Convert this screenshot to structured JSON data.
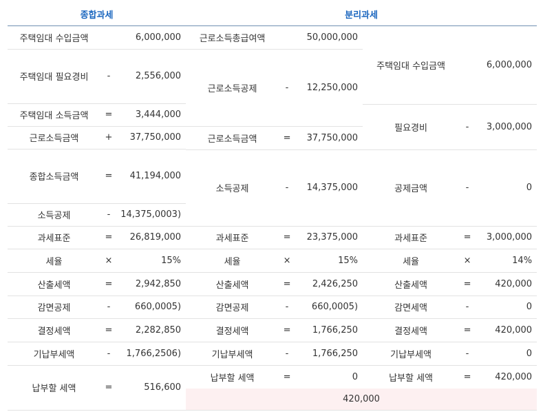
{
  "headers": {
    "combined": "종합과세",
    "separate": "분리과세"
  },
  "col1": {
    "r1": {
      "label": "주택임대 수입금액",
      "op": "",
      "value": "6,000,000"
    },
    "r2": {
      "label": "주택임대 필요경비",
      "op": "-",
      "value": "2,556,000"
    },
    "r3": {
      "label": "주택임대 소득금액",
      "op": "=",
      "value": "3,444,000"
    },
    "r4": {
      "label": "근로소득금액",
      "op": "+",
      "value": "37,750,000"
    },
    "r5": {
      "label": "종합소득금액",
      "op": "=",
      "value": "41,194,000"
    },
    "r6": {
      "label": "소득공제",
      "op": "-",
      "value": "14,375,0003)"
    },
    "r7": {
      "label": "과세표준",
      "op": "=",
      "value": "26,819,000"
    },
    "r8": {
      "label": "세율",
      "op": "×",
      "value": "15%"
    },
    "r9": {
      "label": "산출세액",
      "op": "=",
      "value": "2,942,850"
    },
    "r10": {
      "label": "감면공제",
      "op": "-",
      "value": "660,0005)"
    },
    "r11": {
      "label": "결정세액",
      "op": "=",
      "value": "2,282,850"
    },
    "r12": {
      "label": "기납부세액",
      "op": "-",
      "value": "1,766,2506)"
    },
    "r13": {
      "label": "납부할 세액",
      "op": "=",
      "value": "516,600"
    }
  },
  "col2": {
    "r1": {
      "label": "근로소득총급여액",
      "op": "",
      "value": "50,000,000"
    },
    "r2": {
      "label": "근로소득공제",
      "op": "-",
      "value": "12,250,000"
    },
    "r3": {
      "label": "근로소득금액",
      "op": "=",
      "value": "37,750,000"
    },
    "r4": {
      "label": "소득공제",
      "op": "-",
      "value": "14,375,000"
    },
    "r5": {
      "label": "과세표준",
      "op": "=",
      "value": "23,375,000"
    },
    "r6": {
      "label": "세율",
      "op": "×",
      "value": "15%"
    },
    "r7": {
      "label": "산출세액",
      "op": "=",
      "value": "2,426,250"
    },
    "r8": {
      "label": "감면공제",
      "op": "-",
      "value": "660,0005)"
    },
    "r9": {
      "label": "결정세액",
      "op": "=",
      "value": "1,766,250"
    },
    "r10": {
      "label": "기납부세액",
      "op": "-",
      "value": "1,766,250"
    },
    "r11": {
      "label": "납부할 세액",
      "op": "=",
      "value": "0"
    }
  },
  "col3": {
    "r1": {
      "label": "주택임대 수입금액",
      "op": "",
      "value": "6,000,000"
    },
    "r2": {
      "label": "필요경비",
      "op": "-",
      "value": "3,000,000"
    },
    "r3": {
      "label": "공제금액",
      "op": "-",
      "value": "0"
    },
    "r4": {
      "label": "과세표준",
      "op": "=",
      "value": "3,000,000"
    },
    "r5": {
      "label": "세율",
      "op": "×",
      "value": "14%"
    },
    "r6": {
      "label": "산출세액",
      "op": "=",
      "value": "420,000"
    },
    "r7": {
      "label": "감면세액",
      "op": "-",
      "value": "0"
    },
    "r8": {
      "label": "결정세액",
      "op": "=",
      "value": "420,000"
    },
    "r9": {
      "label": "기납부세액",
      "op": "-",
      "value": "0"
    },
    "r10": {
      "label": "납부할 세액",
      "op": "=",
      "value": "420,000"
    }
  },
  "separate_total": "420,000"
}
